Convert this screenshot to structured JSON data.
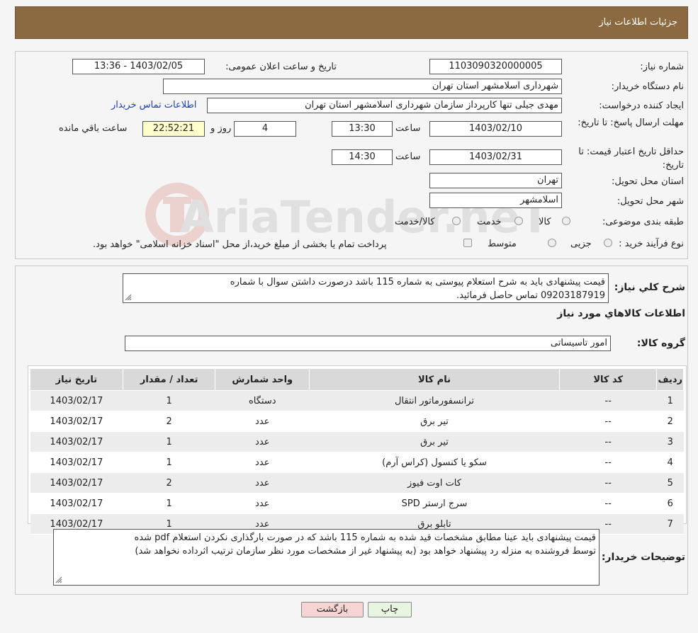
{
  "header": {
    "title": "جزئیات اطلاعات نیاز"
  },
  "form": {
    "need_number_label": "شماره نیاز:",
    "need_number": "1103090320000005",
    "announce_label": "تاریخ و ساعت اعلان عمومی:",
    "announce_value": "1403/02/05 - 13:36",
    "buyer_org_label": "نام دستگاه خریدار:",
    "buyer_org": "شهرداری اسلامشهر استان تهران",
    "creator_label": "ایجاد کننده درخواست:",
    "creator": "مهدی جیلی تنها کارپرداز سازمان  شهرداری اسلامشهر استان تهران",
    "contact_link": "اطلاعات تماس خریدار",
    "deadline_label": "مهلت ارسال پاسخ: تا تاریخ:",
    "deadline_date": "1403/02/10",
    "time_label": "ساعت",
    "deadline_time": "13:30",
    "days_value": "4",
    "days_label": "روز و",
    "remaining_time": "22:52:21",
    "remaining_label": "ساعت باقي مانده",
    "validity_label": "حداقل تاریخ اعتبار قیمت: تا تاریخ:",
    "validity_date": "1403/02/31",
    "validity_time": "14:30",
    "province_label": "استان محل تحویل:",
    "province": "تهران",
    "city_label": "شهر محل تحویل:",
    "city": "اسلامشهر",
    "category_label": "طبقه بندی موضوعی:",
    "category_options": [
      "کالا",
      "خدمت",
      "کالا/خدمت"
    ],
    "purchase_label": "نوع فرآیند خرید :",
    "purchase_options": [
      "جزیی",
      "متوسط"
    ],
    "purchase_note": "پرداخت تمام یا بخشی از مبلغ خرید،از محل \"اسناد خزانه اسلامی\" خواهد بود."
  },
  "details": {
    "summary_label": "شرح کلي نياز:",
    "summary_line1": "قیمت پیشنهادی باید به شرح استعلام پیوستی به شماره 115 باشد درصورت داشتن سوال با شماره",
    "summary_line2": "09203187919 تماس حاصل فرمائید.",
    "goods_info_title": "اطلاعات کالاهاي مورد نياز",
    "goods_group_label": "گروه کالا:",
    "goods_group": "امور تاسیساتی"
  },
  "table": {
    "headers": [
      "رديف",
      "کد کالا",
      "نام کالا",
      "واحد شمارش",
      "تعداد / مقدار",
      "تاريخ نياز"
    ],
    "rows": [
      [
        "1",
        "--",
        "ترانسفورماتور انتقال",
        "دستگاه",
        "1",
        "1403/02/17"
      ],
      [
        "2",
        "--",
        "تیر برق",
        "عدد",
        "2",
        "1403/02/17"
      ],
      [
        "3",
        "--",
        "تیر برق",
        "عدد",
        "1",
        "1403/02/17"
      ],
      [
        "4",
        "--",
        "سکو یا کنسول (کراس آرم)",
        "عدد",
        "1",
        "1403/02/17"
      ],
      [
        "5",
        "--",
        "کات اوت فیوز",
        "عدد",
        "2",
        "1403/02/17"
      ],
      [
        "6",
        "--",
        "سرج ارستر SPD",
        "عدد",
        "1",
        "1403/02/17"
      ],
      [
        "7",
        "--",
        "تابلو برق",
        "عدد",
        "1",
        "1403/02/17"
      ]
    ]
  },
  "buyer_notes": {
    "label": "توضیحات خریدار:",
    "line1": "قیمت پیشنهادی باید عینا مطابق مشخصات قید شده به شماره 115 باشد که در صورت بارگذاری نکردن استعلام pdf شده",
    "line2": "توسط فروشنده به منزله رد پیشنهاد خواهد بود (به پیشنهاد غیر از مشخصات مورد نظر سازمان ترتیب اثرداده نخواهد شد)"
  },
  "buttons": {
    "print": "چاپ",
    "back": "بازگشت"
  },
  "watermark": {
    "text": "AriaTender.neT"
  },
  "colors": {
    "header": "#8b6a42",
    "link": "#1a3dbf",
    "yellow": "#ffffcc",
    "back_button": "#f7d4d4",
    "print_button": "#e8f5e0"
  }
}
